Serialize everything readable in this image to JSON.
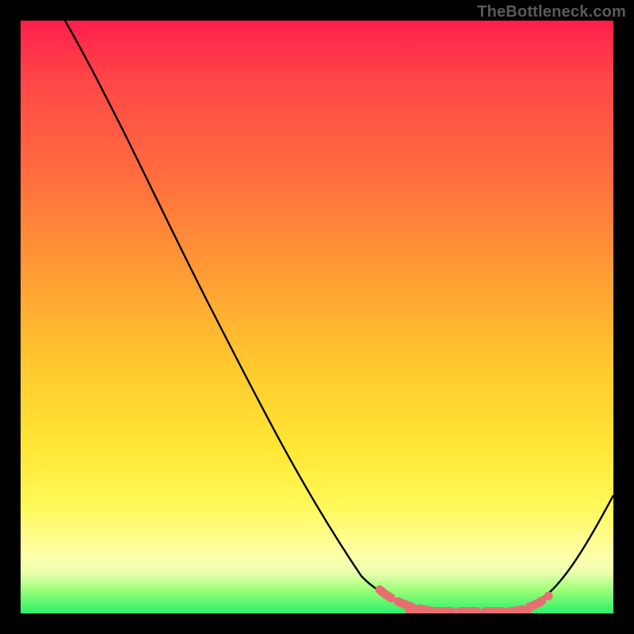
{
  "watermark": "TheBottleneck.com",
  "colors": {
    "gradient_top": "#ff1e4b",
    "gradient_mid_orange": "#ff9a34",
    "gradient_mid_yellow": "#ffe634",
    "gradient_bottom": "#2cf06a",
    "curve": "#000000",
    "valley_marker": "#e76f71",
    "frame": "#000000"
  },
  "chart_data": {
    "type": "line",
    "title": "",
    "xlabel": "",
    "ylabel": "",
    "xlim": [
      0,
      1
    ],
    "ylim": [
      0,
      1
    ],
    "series": [
      {
        "name": "bottleneck-curve",
        "x": [
          0.075,
          0.175,
          0.315,
          0.475,
          0.575,
          0.71,
          0.77,
          0.87,
          0.91,
          1.0
        ],
        "values": [
          1.0,
          0.81,
          0.525,
          0.225,
          0.063,
          0.01,
          0.0,
          0.0,
          0.055,
          0.2
        ]
      }
    ],
    "annotations": [
      {
        "name": "valley-highlight",
        "x_range": [
          0.605,
          0.89
        ],
        "style": "thick-dashed",
        "color": "#e76f71"
      }
    ],
    "legend": false,
    "grid": false
  }
}
